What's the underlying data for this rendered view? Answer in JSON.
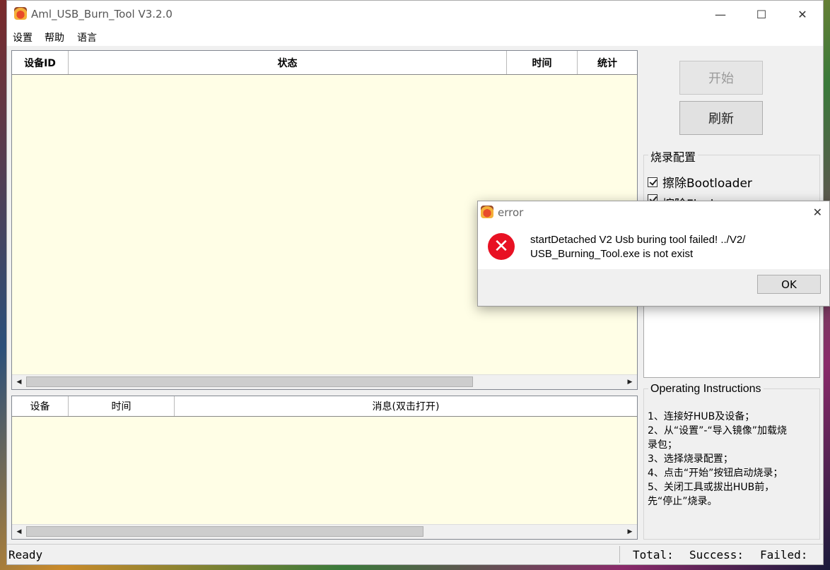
{
  "window": {
    "title": "Aml_USB_Burn_Tool V3.2.0"
  },
  "controls": {
    "minimize": "—",
    "maximize": "☐",
    "close": "✕"
  },
  "menu": [
    "设置",
    "帮助",
    "语言"
  ],
  "device_table": {
    "columns": [
      "设备ID",
      "状态",
      "时间",
      "统计"
    ]
  },
  "log_table": {
    "columns": [
      "设备",
      "时间",
      "消息(双击打开)"
    ]
  },
  "buttons": {
    "start": "开始",
    "refresh": "刷新"
  },
  "burn_config": {
    "title": "烧录配置",
    "options": [
      {
        "label": "擦除Bootloader",
        "checked": true
      },
      {
        "label": "擦除Flash",
        "checked": true
      }
    ]
  },
  "instructions": {
    "title": "Operating Instructions",
    "lines": [
      "1、连接好HUB及设备；",
      "2、从“设置”-“导入镜像”加载烧",
      "录包；",
      "3、选择烧录配置；",
      "4、点击“开始”按钮启动烧录；",
      "5、关闭工具或拔出HUB前，",
      "先“停止”烧录。"
    ]
  },
  "status_bar": {
    "left": "Ready",
    "total": "Total:",
    "success": "Success:",
    "failed": "Failed:"
  },
  "dialog": {
    "title": "error",
    "message_line1": "startDetached V2 Usb buring tool failed! ../V2/",
    "message_line2": "USB_Burning_Tool.exe is not exist",
    "ok": "OK",
    "close": "✕"
  }
}
